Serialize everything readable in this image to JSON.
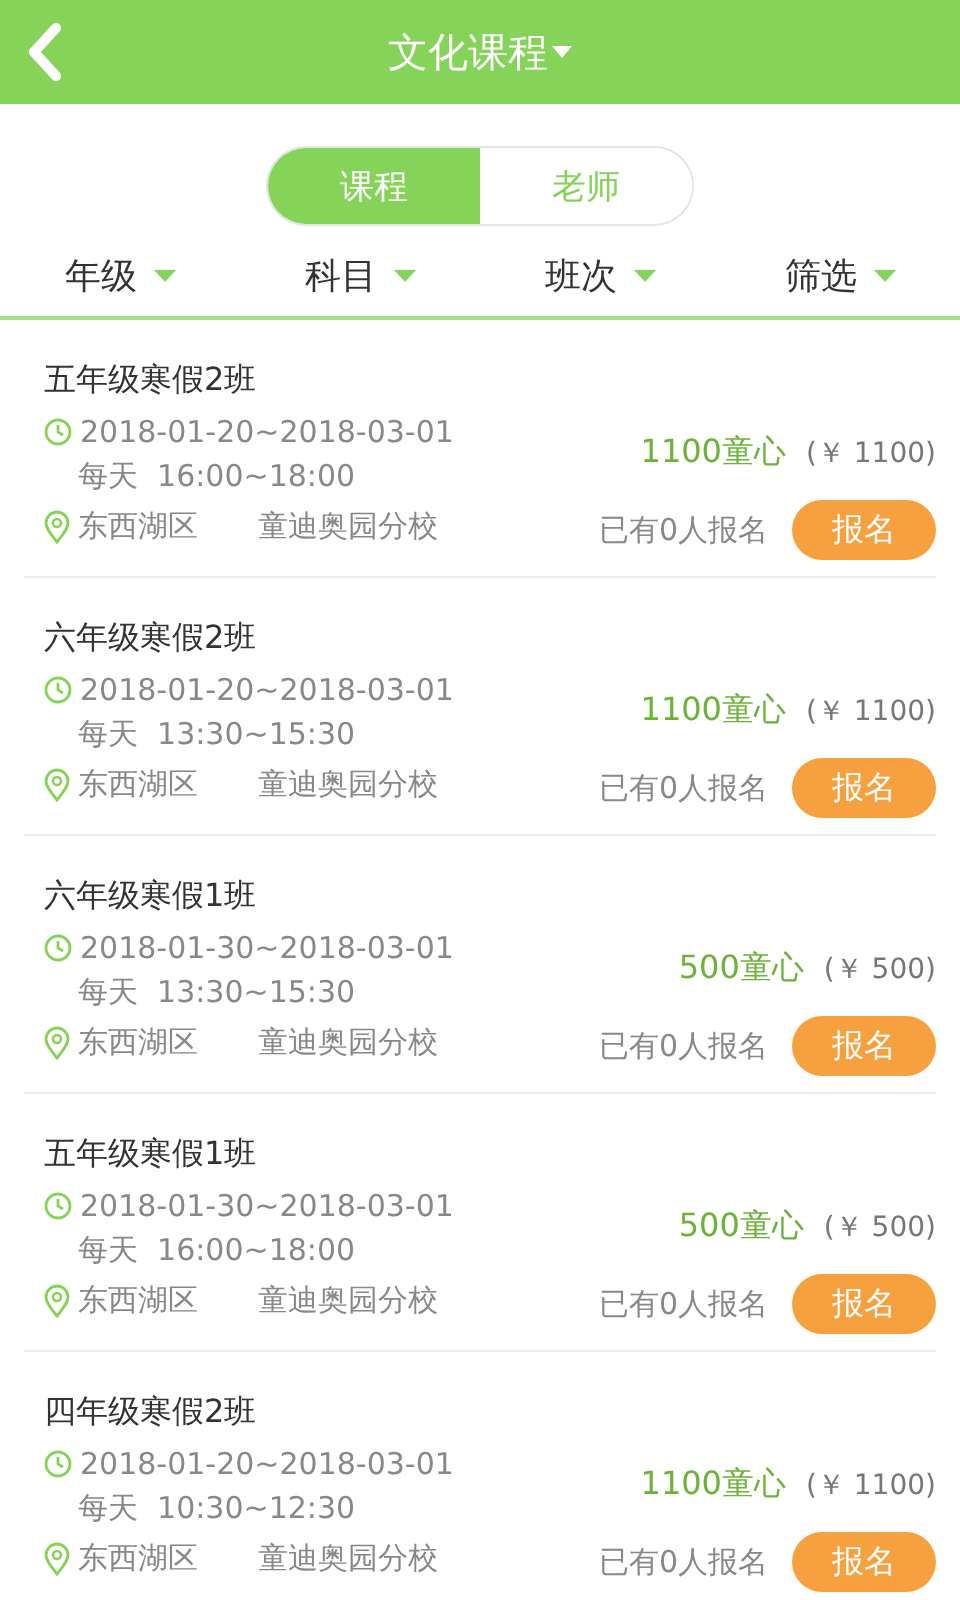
{
  "header": {
    "title": "文化课程"
  },
  "tabs": [
    {
      "label": "课程",
      "selected": true
    },
    {
      "label": "老师",
      "selected": false
    }
  ],
  "filters": [
    "年级",
    "科目",
    "班次",
    "筛选"
  ],
  "courses": [
    {
      "name": "五年级寒假2班",
      "dates": "2018-01-20~2018-03-01",
      "time": "每天  16:00~18:00",
      "district": "东西湖区",
      "campus": "童迪奥园分校",
      "price": "1100童心",
      "cash": "(￥ 1100)",
      "enrolled": "已有0人报名",
      "button": "报名"
    },
    {
      "name": "六年级寒假2班",
      "dates": "2018-01-20~2018-03-01",
      "time": "每天  13:30~15:30",
      "district": "东西湖区",
      "campus": "童迪奥园分校",
      "price": "1100童心",
      "cash": "(￥ 1100)",
      "enrolled": "已有0人报名",
      "button": "报名"
    },
    {
      "name": "六年级寒假1班",
      "dates": "2018-01-30~2018-03-01",
      "time": "每天  13:30~15:30",
      "district": "东西湖区",
      "campus": "童迪奥园分校",
      "price": "500童心",
      "cash": "(￥ 500)",
      "enrolled": "已有0人报名",
      "button": "报名"
    },
    {
      "name": "五年级寒假1班",
      "dates": "2018-01-30~2018-03-01",
      "time": "每天  16:00~18:00",
      "district": "东西湖区",
      "campus": "童迪奥园分校",
      "price": "500童心",
      "cash": "(￥ 500)",
      "enrolled": "已有0人报名",
      "button": "报名"
    },
    {
      "name": "四年级寒假2班",
      "dates": "2018-01-20~2018-03-01",
      "time": "每天  10:30~12:30",
      "district": "东西湖区",
      "campus": "童迪奥园分校",
      "price": "1100童心",
      "cash": "(￥ 1100)",
      "enrolled": "已有0人报名",
      "button": "报名"
    }
  ]
}
